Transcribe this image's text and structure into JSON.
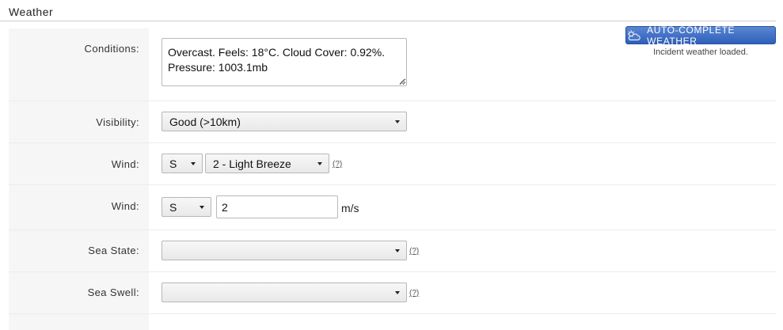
{
  "section": {
    "title": "Weather"
  },
  "auto_complete": {
    "button_label": "AUTO-COMPLETE WEATHER",
    "status": "Incident weather loaded.",
    "icon": "sun-cloud-icon"
  },
  "conditions": {
    "label": "Conditions:",
    "value": "Overcast. Feels: 18°C. Cloud Cover: 0.92%. Pressure: 1003.1mb"
  },
  "visibility": {
    "label": "Visibility:",
    "selected": "Good (>10km)"
  },
  "wind_beaufort": {
    "label": "Wind:",
    "direction": "S",
    "force": "2 - Light Breeze",
    "help": "(?)"
  },
  "wind_speed": {
    "label": "Wind:",
    "direction": "S",
    "value": "2",
    "unit": "m/s"
  },
  "sea_state": {
    "label": "Sea State:",
    "selected": "",
    "help": "(?)"
  },
  "sea_swell": {
    "label": "Sea Swell:",
    "selected": "",
    "help": "(?)"
  }
}
